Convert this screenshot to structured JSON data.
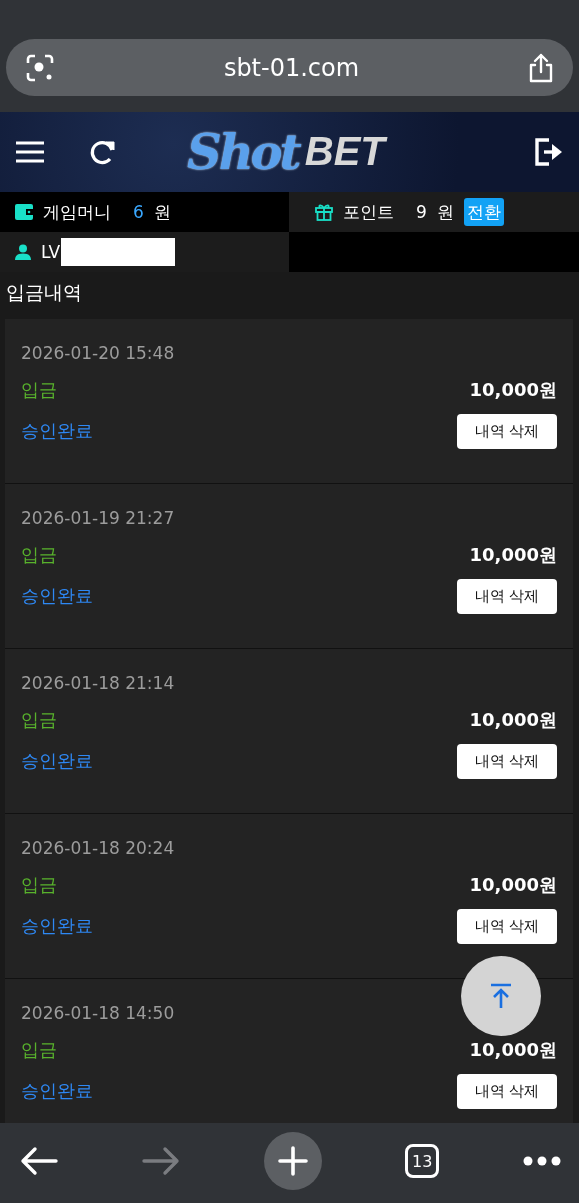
{
  "browser": {
    "url": "sbt-01.com"
  },
  "header": {
    "logo": [
      "Shot",
      "BET"
    ]
  },
  "balance": {
    "game_money": {
      "label": "게임머니",
      "value": "6",
      "unit": "원"
    },
    "points": {
      "label": "포인트",
      "value": "9",
      "unit": "원",
      "convert_button": "전환"
    }
  },
  "user": {
    "level": "LV"
  },
  "page_title": "입금내역",
  "deposits": [
    {
      "date": "2026-01-20 15:48",
      "type": "입금",
      "amount": "10,000원",
      "status": "승인완료",
      "delete_button": "내역 삭제"
    },
    {
      "date": "2026-01-19 21:27",
      "type": "입금",
      "amount": "10,000원",
      "status": "승인완료",
      "delete_button": "내역 삭제"
    },
    {
      "date": "2026-01-18 21:14",
      "type": "입금",
      "amount": "10,000원",
      "status": "승인완료",
      "delete_button": "내역 삭제"
    },
    {
      "date": "2026-01-18 20:24",
      "type": "입금",
      "amount": "10,000원",
      "status": "승인완료",
      "delete_button": "내역 삭제"
    },
    {
      "date": "2026-01-18 14:50",
      "type": "입금",
      "amount": "10,000원",
      "status": "승인완료",
      "delete_button": "내역 삭제"
    }
  ],
  "toolbar": {
    "forward": {
      "disabled": true
    },
    "tab_count": "13"
  }
}
